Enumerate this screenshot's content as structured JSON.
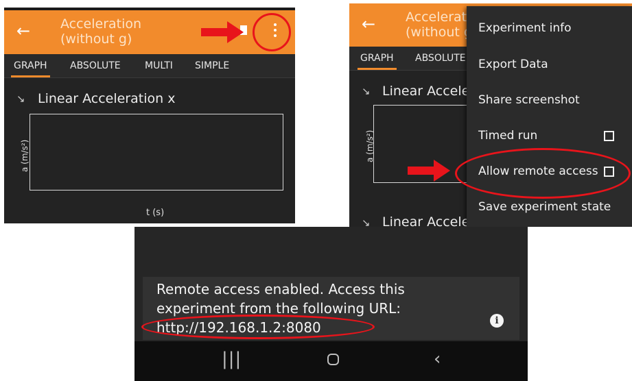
{
  "colors": {
    "accent": "#f28b2c",
    "highlight": "#e8141b",
    "background": "#232323"
  },
  "panel1": {
    "back_icon": "arrow-left-icon",
    "title_line1": "Acceleration",
    "title_line2": "(without g)",
    "tabs": [
      "GRAPH",
      "ABSOLUTE",
      "MULTI",
      "SIMPLE"
    ],
    "sensor_label": "Linear Acceleration x",
    "y_label": "a (m/s²)",
    "x_label": "t (s)",
    "menu_icon": "more-vert-icon"
  },
  "panel2": {
    "title_line1": "Accelerat",
    "title_line2": "(without g",
    "tabs": [
      "GRAPH",
      "ABSOLUTE"
    ],
    "sensor_label": "Linear Accele",
    "sensor_label_bottom": "Linear Acceleration y",
    "y_label": "a (m/s²)",
    "menu": {
      "items": [
        "Experiment info",
        "Export Data",
        "Share screenshot",
        "Timed run",
        "Allow remote access",
        "Save experiment state"
      ],
      "timed_run_checked": false,
      "remote_access_checked": false
    }
  },
  "panel3": {
    "message_line1": "Remote access enabled. Access this",
    "message_line2": "experiment from the following URL:",
    "url": "http://192.168.1.2:8080",
    "info_icon": "info-icon",
    "nav": {
      "recents_icon": "recents-icon",
      "home_icon": "home-icon",
      "back_icon": "back-chevron-icon"
    }
  }
}
